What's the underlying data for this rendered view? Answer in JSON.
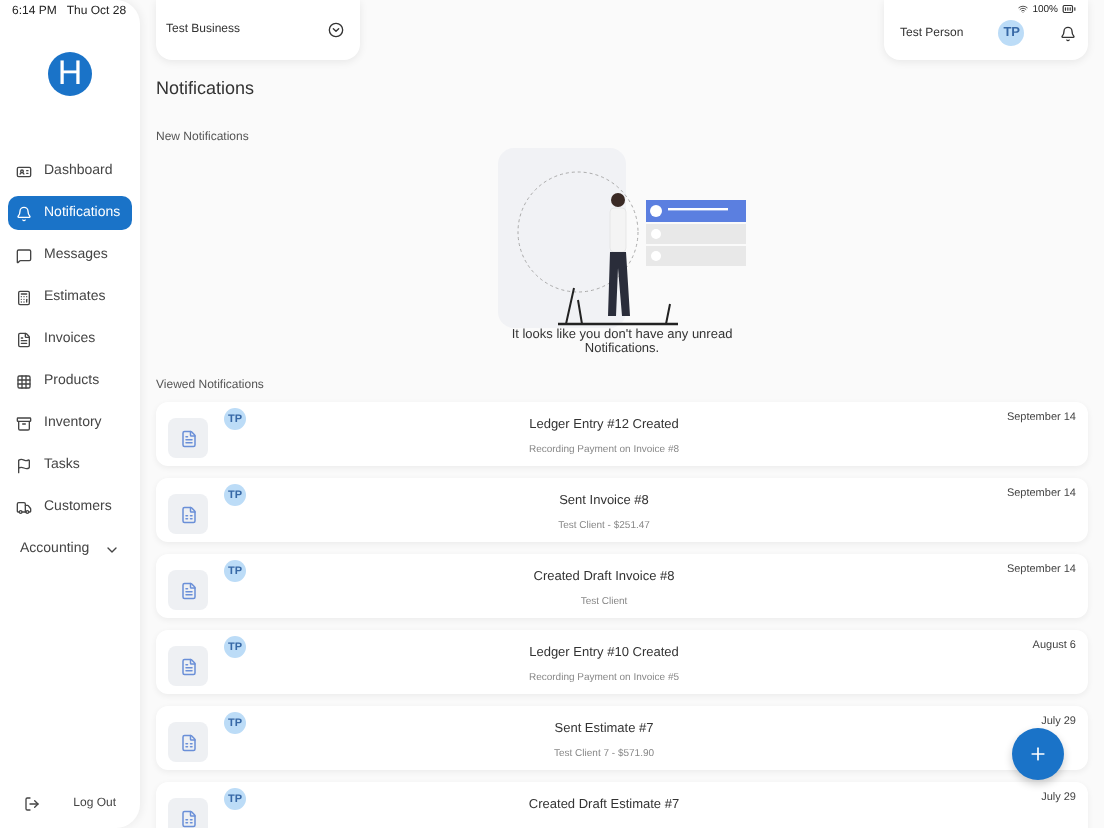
{
  "status_bar": {
    "time": "6:14 PM",
    "date": "Thu Oct 28",
    "battery": "100%"
  },
  "logo": {
    "letter": "H"
  },
  "sidebar": {
    "items": [
      {
        "label": "Dashboard",
        "kind": "dashboard",
        "selected": false
      },
      {
        "label": "Notifications",
        "kind": "bell",
        "selected": true
      },
      {
        "label": "Messages",
        "kind": "messages",
        "selected": false
      },
      {
        "label": "Estimates",
        "kind": "estimates",
        "selected": false
      },
      {
        "label": "Invoices",
        "kind": "invoices",
        "selected": false
      },
      {
        "label": "Products",
        "kind": "products",
        "selected": false
      },
      {
        "label": "Inventory",
        "kind": "inventory",
        "selected": false
      },
      {
        "label": "Tasks",
        "kind": "tasks",
        "selected": false
      },
      {
        "label": "Customers",
        "kind": "customers",
        "selected": false
      },
      {
        "label": "Accounting",
        "kind": "group",
        "selected": false,
        "expanded": false
      }
    ],
    "logout": "Log Out"
  },
  "business": {
    "name": "Test Business"
  },
  "user": {
    "name": "Test Person",
    "initials": "TP"
  },
  "page_title": "Notifications",
  "new_section": {
    "heading": "New Notifications",
    "empty_message": "It looks like you don't have any unread Notifications."
  },
  "viewed_section": {
    "heading": "Viewed Notifications",
    "items": [
      {
        "kind": "invoice",
        "initials": "TP",
        "title": "Ledger Entry #12 Created",
        "subtitle": "Recording Payment on Invoice #8",
        "date": "September 14"
      },
      {
        "kind": "estimate",
        "initials": "TP",
        "title": "Sent Invoice #8",
        "subtitle": "Test Client - $251.47",
        "date": "September 14"
      },
      {
        "kind": "invoice",
        "initials": "TP",
        "title": "Created Draft Invoice #8",
        "subtitle": "Test Client",
        "date": "September 14"
      },
      {
        "kind": "invoice",
        "initials": "TP",
        "title": "Ledger Entry #10 Created",
        "subtitle": "Recording Payment on Invoice #5",
        "date": "August 6"
      },
      {
        "kind": "estimate",
        "initials": "TP",
        "title": "Sent Estimate #7",
        "subtitle": "Test Client 7 - $571.90",
        "date": "July 29"
      },
      {
        "kind": "estimate",
        "initials": "TP",
        "title": "Created Draft Estimate #7",
        "date": "July 29"
      }
    ]
  }
}
